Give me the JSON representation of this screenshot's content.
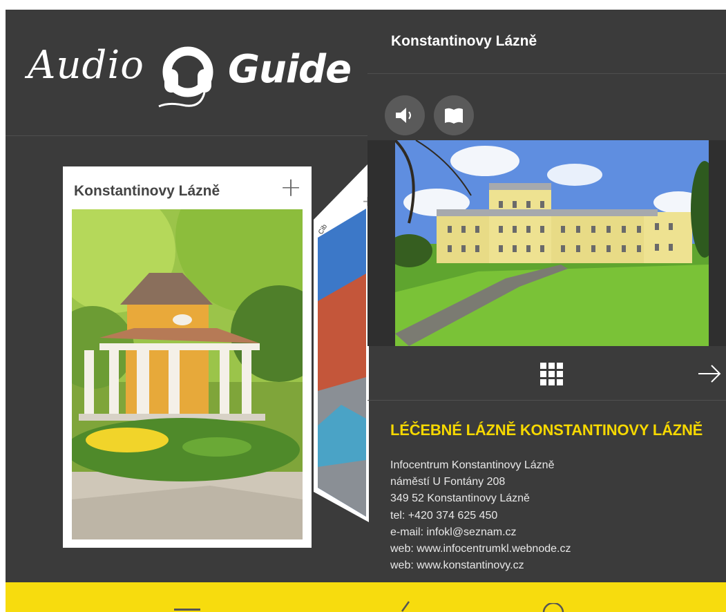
{
  "logo": {
    "word1": "Audio",
    "word2": "Guide"
  },
  "cards": [
    {
      "title": "Konstantinovy Lázně",
      "add_label": "+"
    },
    {
      "title": "Cib"
    }
  ],
  "detail": {
    "title": "Konstantinovy Lázně",
    "actions": [
      {
        "icon": "speaker-icon"
      },
      {
        "icon": "book-icon"
      }
    ],
    "heading": "LÉČEBNÉ LÁZNĚ KONSTANTINOVY LÁZNĚ",
    "info_lines": [
      "Infocentrum Konstantinovy Lázně",
      "náměstí U Fontány 208",
      "349 52 Konstantinovy Lázně",
      "tel: +420 374 625 450",
      "e-mail: infokl@seznam.cz",
      "web: www.infocentrumkl.webnode.cz",
      "web: www.konstantinovy.cz"
    ]
  },
  "colors": {
    "accent": "#f6d800",
    "bar": "#f7dc0e",
    "background": "#3b3b3b"
  },
  "bottom_tabs": [
    {
      "icon": "menu-icon"
    },
    {
      "icon": "back-icon"
    },
    {
      "icon": "search-icon"
    }
  ]
}
